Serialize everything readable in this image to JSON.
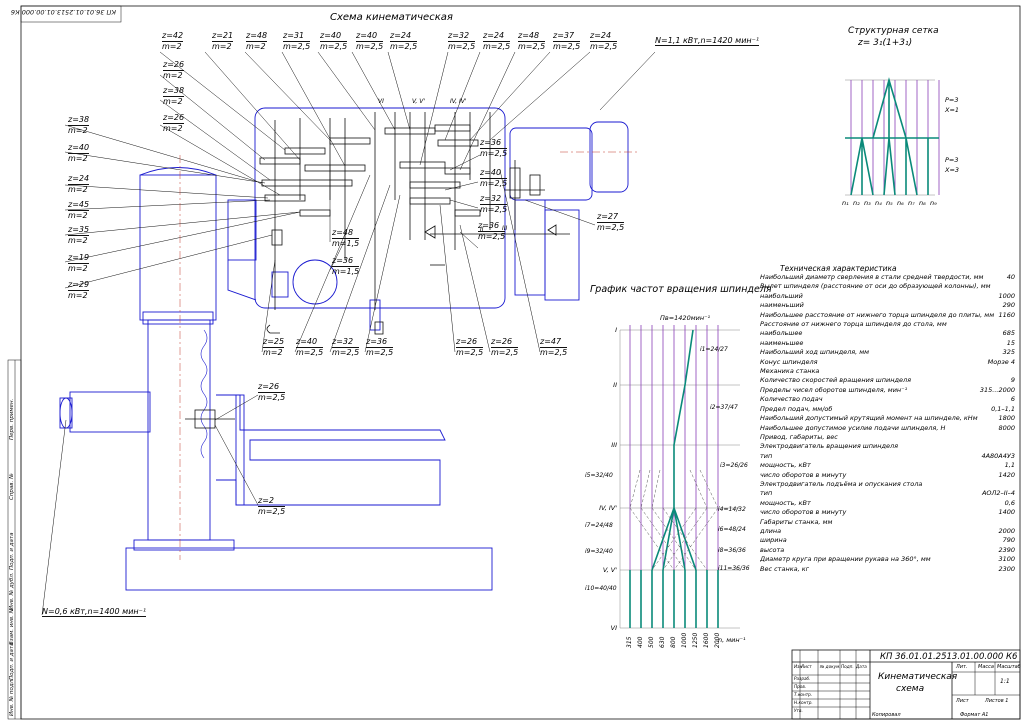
{
  "stamp_top": "КП 36.01.01.2513.01.00.000 К6",
  "titles": {
    "kinematic": "Схема кинематическая",
    "structural": "Структурная сетка",
    "structural_formula": "z= 3₁(1+3₁)",
    "speed_graph": "График частот вращения шпинделя"
  },
  "motor_main": "N=1,1 кВт,n=1420 мин⁻¹",
  "motor_lift": "N=0,6 кВт,n=1400 мин⁻¹",
  "gear_labels_top": [
    {
      "z": "z=42",
      "m": "m=2"
    },
    {
      "z": "z=21",
      "m": "m=2"
    },
    {
      "z": "z=48",
      "m": "m=2"
    },
    {
      "z": "z=31",
      "m": "m=2,5"
    },
    {
      "z": "z=40",
      "m": "m=2,5"
    },
    {
      "z": "z=40",
      "m": "m=2,5"
    },
    {
      "z": "z=24",
      "m": "m=2,5"
    },
    {
      "z": "z=32",
      "m": "m=2,5"
    },
    {
      "z": "z=24",
      "m": "m=2,5"
    },
    {
      "z": "z=48",
      "m": "m=2,5"
    },
    {
      "z": "z=37",
      "m": "m=2,5"
    },
    {
      "z": "z=24",
      "m": "m=2,5"
    }
  ],
  "gear_labels_left": [
    {
      "z": "z=26",
      "m": "m=2"
    },
    {
      "z": "z=38",
      "m": "m=2"
    },
    {
      "z": "z=26",
      "m": "m=2"
    },
    {
      "z": "z=38",
      "m": "m=2"
    },
    {
      "z": "z=40",
      "m": "m=2"
    },
    {
      "z": "z=24",
      "m": "m=2"
    },
    {
      "z": "z=45",
      "m": "m=2"
    },
    {
      "z": "z=35",
      "m": "m=2"
    },
    {
      "z": "z=19",
      "m": "m=2"
    },
    {
      "z": "z=29",
      "m": "m=2"
    }
  ],
  "gear_labels_bottom": [
    {
      "z": "z=25",
      "m": "m=2"
    },
    {
      "z": "z=40",
      "m": "m=2,5"
    },
    {
      "z": "z=32",
      "m": "m=2,5"
    },
    {
      "z": "z=36",
      "m": "m=2,5"
    },
    {
      "z": "z=26",
      "m": "m=2,5"
    },
    {
      "z": "z=26",
      "m": "m=2,5"
    },
    {
      "z": "z=47",
      "m": "m=2,5"
    }
  ],
  "gear_labels_right": [
    {
      "z": "z=36",
      "m": "m=2,5"
    },
    {
      "z": "z=40",
      "m": "m=2,5"
    },
    {
      "z": "z=32",
      "m": "m=2,5"
    },
    {
      "z": "z=36",
      "m": "m=2,5"
    },
    {
      "z": "z=27",
      "m": "m=2,5"
    }
  ],
  "gear_labels_mid": [
    {
      "z": "z=48",
      "m": "m=1,5"
    },
    {
      "z": "z=36",
      "m": "m=1,5"
    },
    {
      "z": "z=26",
      "m": "m=2,5"
    },
    {
      "z": "z=2",
      "m": "m=2,5"
    }
  ],
  "shaft_roman": [
    "VI",
    "V, V'",
    "IV, IV'",
    "II",
    "III"
  ],
  "grid": {
    "p1": "P=3",
    "x1": "X=1",
    "p2": "P=3",
    "x2": "X=3",
    "n_labels": [
      "n₁",
      "n₂",
      "n₃",
      "n₄",
      "n₅",
      "n₆",
      "n₇",
      "n₈",
      "n₉"
    ]
  },
  "speed": {
    "header": "Пв=1420мин⁻¹",
    "shafts": [
      "I",
      "II",
      "III",
      "IV, IV'",
      "V, V'",
      "VI"
    ],
    "ratios": [
      "i1=24/27",
      "i2=37/47",
      "i3=26/26",
      "i4=14/32",
      "i5=32/40",
      "i6=48/24",
      "i7=24/48",
      "i8=36/36",
      "i9=32/40",
      "i10=40/40",
      "i11=36/36"
    ],
    "speeds": [
      "315",
      "400",
      "500",
      "630",
      "800",
      "1000",
      "1250",
      "1600",
      "2000"
    ],
    "unit": "n, мин⁻¹"
  },
  "specs_title": "Техническая характеристика",
  "specs": [
    {
      "label": "Наибольший диаметр сверления в стали средней твердости, мм",
      "value": "40"
    },
    {
      "label": "Вылет шпинделя (расстояние от оси до образующей колонны), мм",
      "value": ""
    },
    {
      "label": "наибольший",
      "value": "1000"
    },
    {
      "label": "наименьший",
      "value": "290"
    },
    {
      "label": "Наибольшее расстояние от нижнего торца шпинделя до плиты, мм",
      "value": "1160"
    },
    {
      "label": "Расстояние от нижнего торца шпинделя до стола, мм",
      "value": ""
    },
    {
      "label": "наибольшее",
      "value": "685"
    },
    {
      "label": "наименьшее",
      "value": "15"
    },
    {
      "label": "Наибольший ход шпинделя, мм",
      "value": "325"
    },
    {
      "label": "Конус шпинделя",
      "value": "Морзе 4"
    },
    {
      "label": "Механика станка",
      "value": ""
    },
    {
      "label": "Количество скоростей вращения шпинделя",
      "value": "9"
    },
    {
      "label": "Пределы чисел оборотов шпинделя, мин⁻¹",
      "value": "315...2000"
    },
    {
      "label": "Количество подач",
      "value": "6"
    },
    {
      "label": "Предел подач, мм/об",
      "value": "0,1–1,1"
    },
    {
      "label": "Наибольший допустимый крутящий момент на шпинделе, кНм",
      "value": "1800"
    },
    {
      "label": "Наибольшее допустимое усилие подачи шпинделя, Н",
      "value": "8000"
    },
    {
      "label": "Привод, габариты, вес",
      "value": ""
    },
    {
      "label": "Электродвигатель вращения шпинделя",
      "value": ""
    },
    {
      "label": "тип",
      "value": "4А80А4У3"
    },
    {
      "label": "мощность, кВт",
      "value": "1,1"
    },
    {
      "label": "число оборотов в минуту",
      "value": "1420"
    },
    {
      "label": "Электродвигатель подъёма и опускания стола",
      "value": ""
    },
    {
      "label": "тип",
      "value": "АОЛ2–II–4"
    },
    {
      "label": "мощность, кВт",
      "value": "0,6"
    },
    {
      "label": "число оборотов в минуту",
      "value": "1400"
    },
    {
      "label": "Габариты станка, мм",
      "value": ""
    },
    {
      "label": "длина",
      "value": "2000"
    },
    {
      "label": "ширина",
      "value": "790"
    },
    {
      "label": "высота",
      "value": "2390"
    },
    {
      "label": "Диаметр круга при вращении рукава на 360°, мм",
      "value": "3100"
    },
    {
      "label": "Вес станка, кг",
      "value": "2300"
    }
  ],
  "titleblock": {
    "code": "КП 36.01.01.2513.01.00.000 К6",
    "name1": "Кинематическая",
    "name2": "схема",
    "sheet": "Лит.",
    "mass": "Масса",
    "scale": "Масштаб",
    "scale_val": "1:1",
    "list": "Лист",
    "lists": "Листов 1",
    "copied": "Копировал",
    "format": "Формат А1",
    "rows": [
      "Изм",
      "Лист",
      "№ докум.",
      "Подп.",
      "Дата",
      "Разраб.",
      "Пров.",
      "Т.контр.",
      "Н.контр.",
      "Утв."
    ]
  },
  "left_margin": [
    "Перв. примен.",
    "Справ. №",
    "Подп. и дата",
    "Инв. № дубл.",
    "Взам. инв. №",
    "Подп. и дата",
    "Инв. № подл."
  ]
}
